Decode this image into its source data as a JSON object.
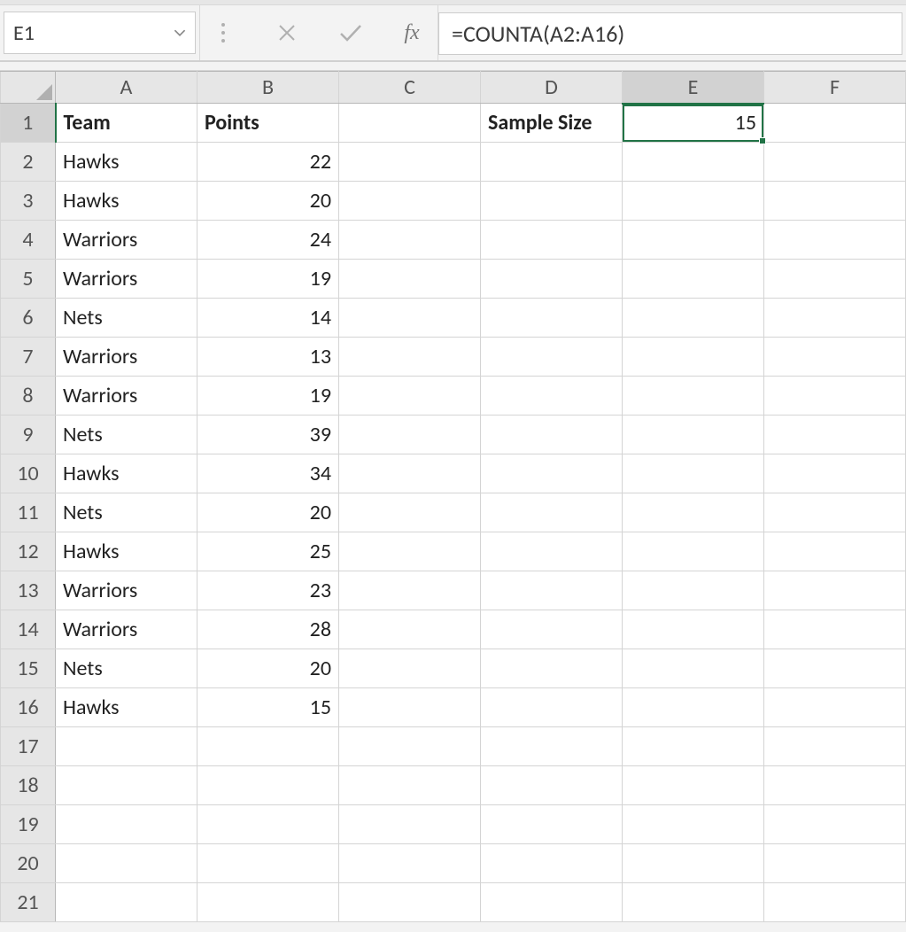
{
  "formula_bar": {
    "cell_reference": "E1",
    "formula": "=COUNTA(A2:A16)"
  },
  "selection": {
    "row": 1,
    "col": "E"
  },
  "columns": [
    "A",
    "B",
    "C",
    "D",
    "E",
    "F"
  ],
  "rows": [
    1,
    2,
    3,
    4,
    5,
    6,
    7,
    8,
    9,
    10,
    11,
    12,
    13,
    14,
    15,
    16,
    17,
    18,
    19,
    20,
    21
  ],
  "headers": {
    "A": "Team",
    "B": "Points",
    "D": "Sample Size"
  },
  "sample_size_value": 15,
  "data_rows": [
    {
      "team": "Hawks",
      "points": 22
    },
    {
      "team": "Hawks",
      "points": 20
    },
    {
      "team": "Warriors",
      "points": 24
    },
    {
      "team": "Warriors",
      "points": 19
    },
    {
      "team": "Nets",
      "points": 14
    },
    {
      "team": "Warriors",
      "points": 13
    },
    {
      "team": "Warriors",
      "points": 19
    },
    {
      "team": "Nets",
      "points": 39
    },
    {
      "team": "Hawks",
      "points": 34
    },
    {
      "team": "Nets",
      "points": 20
    },
    {
      "team": "Hawks",
      "points": 25
    },
    {
      "team": "Warriors",
      "points": 23
    },
    {
      "team": "Warriors",
      "points": 28
    },
    {
      "team": "Nets",
      "points": 20
    },
    {
      "team": "Hawks",
      "points": 15
    }
  ],
  "icons": {
    "dropdown": "chevron-down-icon",
    "cancel": "cancel-icon",
    "enter": "enter-icon",
    "fx": "fx-icon",
    "dots": "dots-icon"
  }
}
